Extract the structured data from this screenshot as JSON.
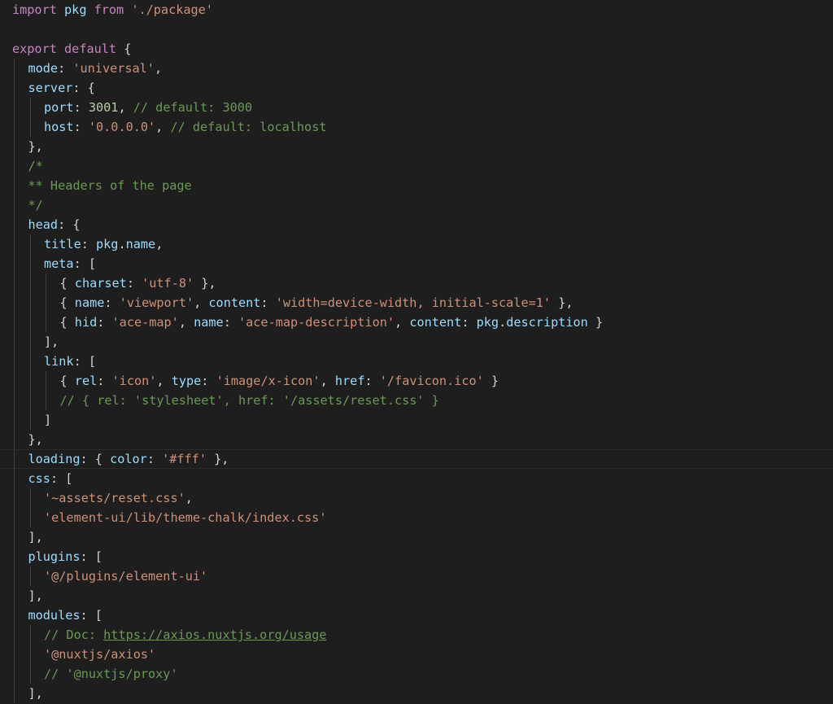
{
  "editor": {
    "language": "javascript",
    "colors": {
      "background": "#1e1e1e",
      "keyword": "#c586c0",
      "identifier": "#9cdcfe",
      "property": "#9cdcfe",
      "string": "#ce9178",
      "number": "#b5cea8",
      "comment": "#6a9955",
      "punctuation": "#d4d4d4",
      "indent_guide": "#404040"
    },
    "current_line": 23,
    "lines": [
      {
        "indent": 0,
        "tokens": [
          [
            "keyword",
            "import"
          ],
          [
            "punct",
            " "
          ],
          [
            "ident",
            "pkg"
          ],
          [
            "punct",
            " "
          ],
          [
            "keyword",
            "from"
          ],
          [
            "punct",
            " "
          ],
          [
            "string",
            "'./package'"
          ]
        ]
      },
      {
        "indent": 0,
        "tokens": []
      },
      {
        "indent": 0,
        "tokens": [
          [
            "keyword",
            "export"
          ],
          [
            "punct",
            " "
          ],
          [
            "keyword",
            "default"
          ],
          [
            "punct",
            " {"
          ]
        ]
      },
      {
        "indent": 1,
        "tokens": [
          [
            "prop",
            "mode"
          ],
          [
            "punct",
            ": "
          ],
          [
            "string",
            "'universal'"
          ],
          [
            "punct",
            ","
          ]
        ]
      },
      {
        "indent": 1,
        "tokens": [
          [
            "prop",
            "server"
          ],
          [
            "punct",
            ": {"
          ]
        ]
      },
      {
        "indent": 2,
        "tokens": [
          [
            "prop",
            "port"
          ],
          [
            "punct",
            ": "
          ],
          [
            "number",
            "3001"
          ],
          [
            "punct",
            ", "
          ],
          [
            "comment",
            "// default: 3000"
          ]
        ]
      },
      {
        "indent": 2,
        "tokens": [
          [
            "prop",
            "host"
          ],
          [
            "punct",
            ": "
          ],
          [
            "string",
            "'0.0.0.0'"
          ],
          [
            "punct",
            ", "
          ],
          [
            "comment",
            "// default: localhost"
          ]
        ]
      },
      {
        "indent": 1,
        "tokens": [
          [
            "punct",
            "},"
          ]
        ]
      },
      {
        "indent": 1,
        "tokens": [
          [
            "comment",
            "/*"
          ]
        ]
      },
      {
        "indent": 1,
        "tokens": [
          [
            "comment",
            "** Headers of the page"
          ]
        ]
      },
      {
        "indent": 1,
        "tokens": [
          [
            "comment",
            "*/"
          ]
        ]
      },
      {
        "indent": 1,
        "tokens": [
          [
            "prop",
            "head"
          ],
          [
            "punct",
            ": {"
          ]
        ]
      },
      {
        "indent": 2,
        "tokens": [
          [
            "prop",
            "title"
          ],
          [
            "punct",
            ": "
          ],
          [
            "ident",
            "pkg"
          ],
          [
            "punct",
            "."
          ],
          [
            "prop",
            "name"
          ],
          [
            "punct",
            ","
          ]
        ]
      },
      {
        "indent": 2,
        "tokens": [
          [
            "prop",
            "meta"
          ],
          [
            "punct",
            ": ["
          ]
        ]
      },
      {
        "indent": 3,
        "tokens": [
          [
            "punct",
            "{ "
          ],
          [
            "prop",
            "charset"
          ],
          [
            "punct",
            ": "
          ],
          [
            "string",
            "'utf-8'"
          ],
          [
            "punct",
            " },"
          ]
        ]
      },
      {
        "indent": 3,
        "tokens": [
          [
            "punct",
            "{ "
          ],
          [
            "prop",
            "name"
          ],
          [
            "punct",
            ": "
          ],
          [
            "string",
            "'viewport'"
          ],
          [
            "punct",
            ", "
          ],
          [
            "prop",
            "content"
          ],
          [
            "punct",
            ": "
          ],
          [
            "string",
            "'width=device-width, initial-scale=1'"
          ],
          [
            "punct",
            " },"
          ]
        ]
      },
      {
        "indent": 3,
        "tokens": [
          [
            "punct",
            "{ "
          ],
          [
            "prop",
            "hid"
          ],
          [
            "punct",
            ": "
          ],
          [
            "string",
            "'ace-map'"
          ],
          [
            "punct",
            ", "
          ],
          [
            "prop",
            "name"
          ],
          [
            "punct",
            ": "
          ],
          [
            "string",
            "'ace-map-description'"
          ],
          [
            "punct",
            ", "
          ],
          [
            "prop",
            "content"
          ],
          [
            "punct",
            ": "
          ],
          [
            "ident",
            "pkg"
          ],
          [
            "punct",
            "."
          ],
          [
            "prop",
            "description"
          ],
          [
            "punct",
            " }"
          ]
        ]
      },
      {
        "indent": 2,
        "tokens": [
          [
            "punct",
            "],"
          ]
        ]
      },
      {
        "indent": 2,
        "tokens": [
          [
            "prop",
            "link"
          ],
          [
            "punct",
            ": ["
          ]
        ]
      },
      {
        "indent": 3,
        "tokens": [
          [
            "punct",
            "{ "
          ],
          [
            "prop",
            "rel"
          ],
          [
            "punct",
            ": "
          ],
          [
            "string",
            "'icon'"
          ],
          [
            "punct",
            ", "
          ],
          [
            "prop",
            "type"
          ],
          [
            "punct",
            ": "
          ],
          [
            "string",
            "'image/x-icon'"
          ],
          [
            "punct",
            ", "
          ],
          [
            "prop",
            "href"
          ],
          [
            "punct",
            ": "
          ],
          [
            "string",
            "'/favicon.ico'"
          ],
          [
            "punct",
            " }"
          ]
        ]
      },
      {
        "indent": 3,
        "tokens": [
          [
            "comment",
            "// { rel: 'stylesheet', href: '/assets/reset.css' }"
          ]
        ]
      },
      {
        "indent": 2,
        "tokens": [
          [
            "punct",
            "]"
          ]
        ]
      },
      {
        "indent": 1,
        "tokens": [
          [
            "punct",
            "},"
          ]
        ]
      },
      {
        "indent": 1,
        "tokens": [
          [
            "prop",
            "loading"
          ],
          [
            "punct",
            ": { "
          ],
          [
            "prop",
            "color"
          ],
          [
            "punct",
            ": "
          ],
          [
            "string",
            "'#fff'"
          ],
          [
            "punct",
            " },"
          ]
        ]
      },
      {
        "indent": 1,
        "tokens": [
          [
            "prop",
            "css"
          ],
          [
            "punct",
            ": ["
          ]
        ]
      },
      {
        "indent": 2,
        "tokens": [
          [
            "string",
            "'~assets/reset.css'"
          ],
          [
            "punct",
            ","
          ]
        ]
      },
      {
        "indent": 2,
        "tokens": [
          [
            "string",
            "'element-ui/lib/theme-chalk/index.css'"
          ]
        ]
      },
      {
        "indent": 1,
        "tokens": [
          [
            "punct",
            "],"
          ]
        ]
      },
      {
        "indent": 1,
        "tokens": [
          [
            "prop",
            "plugins"
          ],
          [
            "punct",
            ": ["
          ]
        ]
      },
      {
        "indent": 2,
        "tokens": [
          [
            "string",
            "'@/plugins/element-ui'"
          ]
        ]
      },
      {
        "indent": 1,
        "tokens": [
          [
            "punct",
            "],"
          ]
        ]
      },
      {
        "indent": 1,
        "tokens": [
          [
            "prop",
            "modules"
          ],
          [
            "punct",
            ": ["
          ]
        ]
      },
      {
        "indent": 2,
        "tokens": [
          [
            "comment",
            "// Doc: "
          ],
          [
            "link",
            "https://axios.nuxtjs.org/usage"
          ]
        ]
      },
      {
        "indent": 2,
        "tokens": [
          [
            "string",
            "'@nuxtjs/axios'"
          ]
        ]
      },
      {
        "indent": 2,
        "tokens": [
          [
            "comment",
            "// '@nuxtjs/proxy'"
          ]
        ]
      },
      {
        "indent": 1,
        "tokens": [
          [
            "punct",
            "],"
          ]
        ]
      }
    ]
  }
}
